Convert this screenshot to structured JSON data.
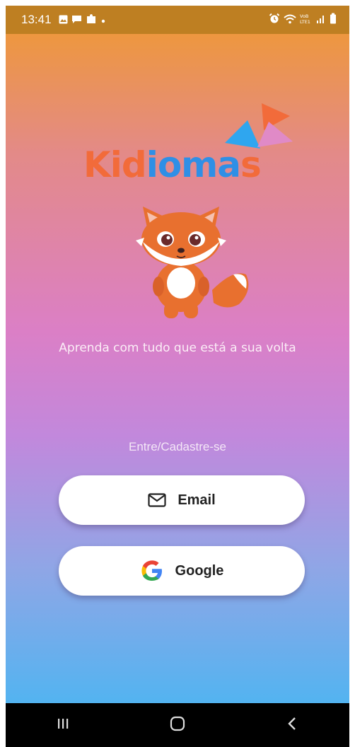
{
  "status_bar": {
    "time": "13:41",
    "left_icons": [
      "gallery-icon",
      "chat-icon",
      "puzzle-icon",
      "dot-icon"
    ],
    "right_icons": [
      "alarm-icon",
      "wifi-icon",
      "volte-icon",
      "signal-icon",
      "battery-icon"
    ],
    "volte_text": "VoB LTE1"
  },
  "logo": {
    "k": "K",
    "id": "id",
    "iomas": "ioma",
    "s": "s",
    "colors": {
      "orange": "#f26b3a",
      "blue": "#2f8fe6",
      "pink": "#e08ac7"
    }
  },
  "mascot": {
    "icon": "fox-mascot-icon"
  },
  "tagline": "Aprenda com tudo que está a sua volta",
  "signin_label": "Entre/Cadastre-se",
  "buttons": {
    "email": {
      "label": "Email",
      "icon": "mail-icon"
    },
    "google": {
      "label": "Google",
      "icon": "google-icon"
    }
  },
  "nav_bar": {
    "items": [
      "recent-apps-icon",
      "home-icon",
      "back-icon"
    ]
  }
}
